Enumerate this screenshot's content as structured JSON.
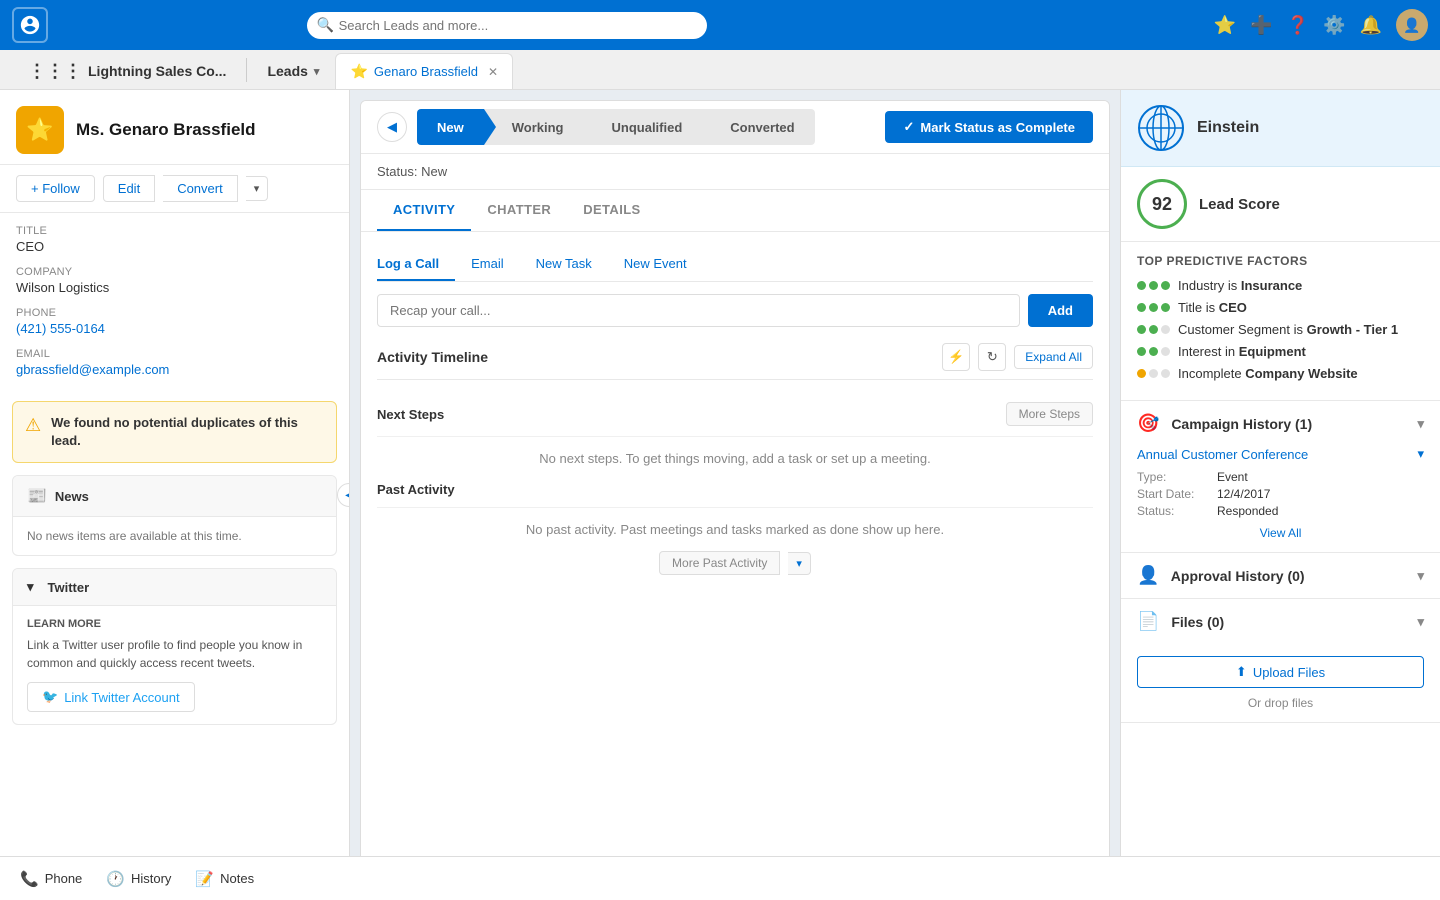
{
  "app": {
    "logo_label": "Salesforce",
    "search_placeholder": "Search Leads and more...",
    "nav_items": [
      "favorites-icon",
      "add-icon",
      "help-icon",
      "settings-icon",
      "notifications-icon",
      "user-avatar"
    ]
  },
  "tab_bar": {
    "app_name": "Lightning Sales Co...",
    "nav_label": "Leads",
    "active_tab_label": "Genaro Brassfield",
    "active_tab_icon": "⭐"
  },
  "lead": {
    "name": "Ms. Genaro Brassfield",
    "follow_label": "+ Follow",
    "edit_label": "Edit",
    "convert_label": "Convert",
    "title_label": "Title",
    "title_value": "CEO",
    "company_label": "Company",
    "company_value": "Wilson Logistics",
    "phone_label": "Phone",
    "phone_value": "(421) 555-0164",
    "email_label": "Email",
    "email_value": "gbrassfield@example.com",
    "duplicate_alert": "We found no potential duplicates of this lead.",
    "news_title": "News",
    "news_body": "No news items are available at this time.",
    "twitter_title": "Twitter",
    "twitter_learn_more": "Learn More",
    "twitter_desc": "Link a Twitter user profile to find people you know in common and quickly access recent tweets.",
    "twitter_link_label": "Link Twitter Account"
  },
  "status_bar": {
    "stages": [
      "New",
      "Working",
      "Unqualified",
      "Converted"
    ],
    "active_stage": "New",
    "status_text": "Status: New",
    "mark_complete_label": "Mark Status as Complete"
  },
  "activity": {
    "tabs": [
      "ACTIVITY",
      "CHATTER",
      "DETAILS"
    ],
    "active_tab": "ACTIVITY",
    "action_tabs": [
      "Log a Call",
      "Email",
      "New Task",
      "New Event"
    ],
    "active_action_tab": "Log a Call",
    "call_placeholder": "Recap your call...",
    "add_label": "Add",
    "timeline_title": "Activity Timeline",
    "expand_all_label": "Expand All",
    "next_steps_title": "Next Steps",
    "more_steps_label": "More Steps",
    "next_steps_empty": "No next steps. To get things moving, add a task or set up a meeting.",
    "past_activity_title": "Past Activity",
    "past_activity_empty": "No past activity. Past meetings and tasks marked as done show up here.",
    "more_past_label": "More Past Activity"
  },
  "einstein": {
    "label": "Einstein",
    "lead_score_label": "Lead Score",
    "lead_score_value": "92",
    "factors_title": "TOP PREDICTIVE FACTORS",
    "factors": [
      {
        "dots": [
          1,
          1,
          1
        ],
        "text": "Industry is ",
        "highlight": "Insurance"
      },
      {
        "dots": [
          1,
          1,
          1
        ],
        "text": "Title is ",
        "highlight": "CEO"
      },
      {
        "dots": [
          1,
          1,
          0
        ],
        "text": "Customer Segment is ",
        "highlight": "Growth - Tier 1"
      },
      {
        "dots": [
          1,
          1,
          0
        ],
        "text": "Interest in ",
        "highlight": "Equipment"
      },
      {
        "dots": [
          0,
          0,
          0
        ],
        "text": "Incomplete ",
        "highlight": "Company Website"
      }
    ]
  },
  "campaign_history": {
    "title": "Campaign History (1)",
    "campaign_name": "Annual Customer Conference",
    "campaign_type_label": "Type:",
    "campaign_type_value": "Event",
    "campaign_start_label": "Start Date:",
    "campaign_start_value": "12/4/2017",
    "campaign_status_label": "Status:",
    "campaign_status_value": "Responded",
    "view_all_label": "View All"
  },
  "approval_history": {
    "title": "Approval History (0)"
  },
  "files": {
    "title": "Files (0)",
    "upload_label": "Upload Files",
    "drop_text": "Or drop files"
  },
  "bottom_bar": {
    "items": [
      {
        "icon": "📞",
        "label": "Phone"
      },
      {
        "icon": "🕐",
        "label": "History"
      },
      {
        "icon": "📝",
        "label": "Notes"
      }
    ]
  }
}
